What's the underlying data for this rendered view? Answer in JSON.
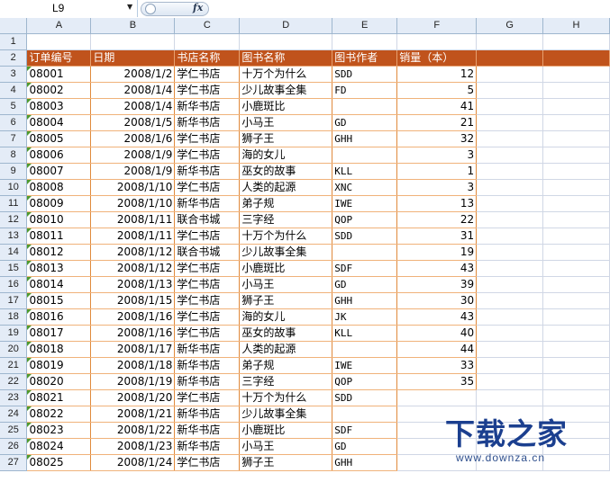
{
  "formula_bar": {
    "name_box": "L9",
    "fx_label": "fx",
    "formula": ""
  },
  "columns": [
    "A",
    "B",
    "C",
    "D",
    "E",
    "F",
    "G",
    "H"
  ],
  "row_numbers": [
    "1",
    "2",
    "3",
    "4",
    "5",
    "6",
    "7",
    "8",
    "9",
    "10",
    "11",
    "12",
    "13",
    "14",
    "15",
    "16",
    "17",
    "18",
    "19",
    "20",
    "21",
    "22",
    "23",
    "24",
    "25",
    "26",
    "27"
  ],
  "table": {
    "headers": [
      "订单编号",
      "日期",
      "书店名称",
      "图书名称",
      "图书作者",
      "销量（本）"
    ],
    "rows": [
      [
        "08001",
        "2008/1/2",
        "学仁书店",
        "十万个为什么",
        "SDD",
        "12"
      ],
      [
        "08002",
        "2008/1/4",
        "学仁书店",
        "少儿故事全集",
        "FD",
        "5"
      ],
      [
        "08003",
        "2008/1/4",
        "新华书店",
        "小鹿斑比",
        "",
        "41"
      ],
      [
        "08004",
        "2008/1/5",
        "新华书店",
        "小马王",
        "GD",
        "21"
      ],
      [
        "08005",
        "2008/1/6",
        "学仁书店",
        "狮子王",
        "GHH",
        "32"
      ],
      [
        "08006",
        "2008/1/9",
        "学仁书店",
        "海的女儿",
        "",
        "3"
      ],
      [
        "08007",
        "2008/1/9",
        "新华书店",
        "巫女的故事",
        "KLL",
        "1"
      ],
      [
        "08008",
        "2008/1/10",
        "学仁书店",
        "人类的起源",
        "XNC",
        "3"
      ],
      [
        "08009",
        "2008/1/10",
        "新华书店",
        "弟子规",
        "IWE",
        "13"
      ],
      [
        "08010",
        "2008/1/11",
        "联合书城",
        "三字经",
        "QOP",
        "22"
      ],
      [
        "08011",
        "2008/1/11",
        "学仁书店",
        "十万个为什么",
        "SDD",
        "31"
      ],
      [
        "08012",
        "2008/1/12",
        "联合书城",
        "少儿故事全集",
        "",
        "19"
      ],
      [
        "08013",
        "2008/1/12",
        "学仁书店",
        "小鹿斑比",
        "SDF",
        "43"
      ],
      [
        "08014",
        "2008/1/13",
        "学仁书店",
        "小马王",
        "GD",
        "39"
      ],
      [
        "08015",
        "2008/1/15",
        "学仁书店",
        "狮子王",
        "GHH",
        "30"
      ],
      [
        "08016",
        "2008/1/16",
        "学仁书店",
        "海的女儿",
        "JK",
        "43"
      ],
      [
        "08017",
        "2008/1/16",
        "学仁书店",
        "巫女的故事",
        "KLL",
        "40"
      ],
      [
        "08018",
        "2008/1/17",
        "新华书店",
        "人类的起源",
        "",
        "44"
      ],
      [
        "08019",
        "2008/1/18",
        "新华书店",
        "弟子规",
        "IWE",
        "33"
      ],
      [
        "08020",
        "2008/1/19",
        "新华书店",
        "三字经",
        "QOP",
        "35"
      ],
      [
        "08021",
        "2008/1/20",
        "学仁书店",
        "十万个为什么",
        "SDD",
        ""
      ],
      [
        "08022",
        "2008/1/21",
        "新华书店",
        "少儿故事全集",
        "",
        ""
      ],
      [
        "08023",
        "2008/1/22",
        "新华书店",
        "小鹿斑比",
        "SDF",
        ""
      ],
      [
        "08024",
        "2008/1/23",
        "新华书店",
        "小马王",
        "GD",
        ""
      ],
      [
        "08025",
        "2008/1/24",
        "学仁书店",
        "狮子王",
        "GHH",
        ""
      ]
    ]
  },
  "watermark": {
    "logo": "下载之家",
    "url": "www.downza.cn"
  }
}
